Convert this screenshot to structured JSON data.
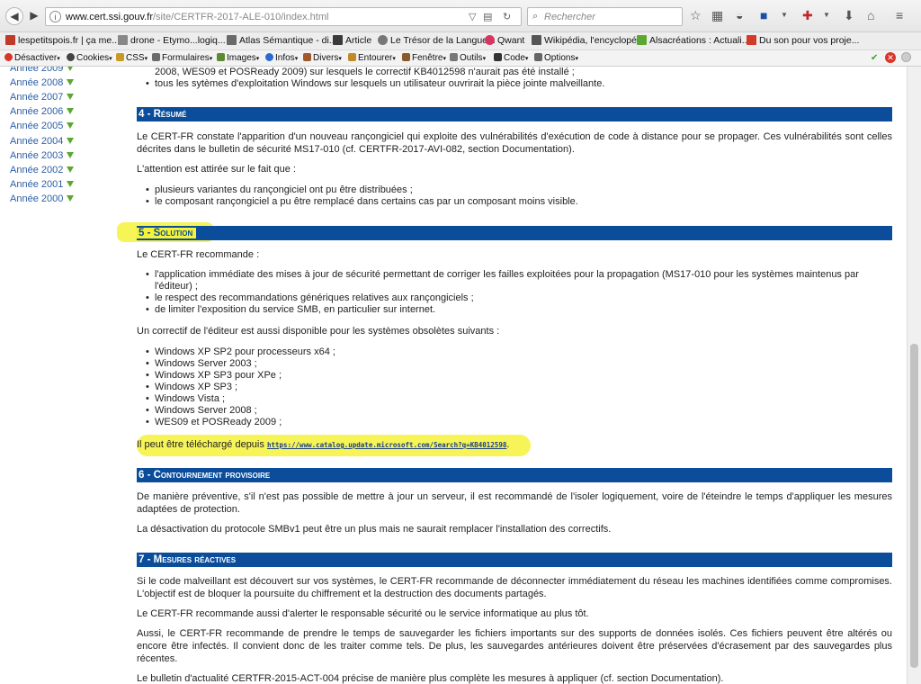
{
  "browser": {
    "url_domain": "www.cert.ssi.gouv.fr",
    "url_path": "/site/CERTFR-2017-ALE-010/index.html",
    "search_placeholder": "Rechercher"
  },
  "bookmarks": [
    {
      "label": "lespetitspois.fr | ça me...",
      "color": "#c0392b"
    },
    {
      "label": "drone - Etymo...logiq...",
      "color": "#888888"
    },
    {
      "label": "Atlas Sémantique - di...",
      "color": "#6a6a6a"
    },
    {
      "label": "Article",
      "color": "#3a3a3a"
    },
    {
      "label": "Le Trésor de la Langue...",
      "color": "#777777"
    },
    {
      "label": "Qwant",
      "color": "#d6365f"
    },
    {
      "label": "Wikipédia, l'encyclopé...",
      "color": "#555555"
    },
    {
      "label": "Alsacréations : Actuali...",
      "color": "#5aa832"
    },
    {
      "label": "Du son pour vos proje...",
      "color": "#d43a2a"
    }
  ],
  "devbar": [
    {
      "label": "Désactiver",
      "color": "#d9352a"
    },
    {
      "label": "Cookies",
      "color": "#444444"
    },
    {
      "label": "CSS",
      "color": "#c79a24"
    },
    {
      "label": "Formulaires",
      "color": "#6b6b6b"
    },
    {
      "label": "Images",
      "color": "#5b8a2f"
    },
    {
      "label": "Infos",
      "color": "#2b6bd0"
    },
    {
      "label": "Divers",
      "color": "#a05a2c"
    },
    {
      "label": "Entourer",
      "color": "#c08a2a"
    },
    {
      "label": "Fenêtre",
      "color": "#8a5a2a"
    },
    {
      "label": "Outils",
      "color": "#777777"
    },
    {
      "label": "Code",
      "color": "#333333"
    },
    {
      "label": "Options",
      "color": "#666666"
    }
  ],
  "sidebar": {
    "years": [
      "Année 2009",
      "Année 2008",
      "Année 2007",
      "Année 2006",
      "Année 2005",
      "Année 2004",
      "Année 2003",
      "Année 2002",
      "Année 2001",
      "Année 2000"
    ]
  },
  "content": {
    "top_bullets": [
      "2008, WES09 et POSReady 2009) sur lesquels le correctif KB4012598 n'aurait pas été installé ;",
      "tous les sytèmes d'exploitation Windows sur lesquels un utilisateur ouvrirait la pièce jointe malveillante."
    ],
    "s4_title": "4 - Résumé",
    "s4_p1": "Le CERT-FR constate l'apparition d'un nouveau rançongiciel qui exploite des vulnérabilités d'exécution de code à distance pour se propager. Ces vulnérabilités sont celles décrites dans le bulletin de sécurité MS17-010 (cf. CERTFR-2017-AVI-082, section Documentation).",
    "s4_p2": "L'attention est attirée sur le fait que :",
    "s4_bullets": [
      "plusieurs variantes du rançongiciel ont pu être distribuées ;",
      "le composant rançongiciel a pu être remplacé dans certains cas par un composant moins visible."
    ],
    "s5_title": "5 - Solution",
    "s5_p1": "Le CERT-FR recommande :",
    "s5_bullets": [
      "l'application immédiate des mises à jour de sécurité permettant de corriger les failles exploitées pour la propagation (MS17-010 pour les systèmes maintenus par l'éditeur) ;",
      "le respect des recommandations génériques relatives aux rançongiciels ;",
      "de limiter l'exposition du service SMB, en particulier sur internet."
    ],
    "s5_p2": "Un correctif de l'éditeur est aussi disponible pour les systèmes obsolètes suivants :",
    "s5_os": [
      "Windows XP SP2 pour processeurs x64 ;",
      "Windows Server 2003 ;",
      "Windows XP SP3 pour XPe ;",
      "Windows XP SP3 ;",
      "Windows Vista ;",
      "Windows Server 2008 ;",
      "WES09 et POSReady 2009 ;"
    ],
    "s5_download_text": "Il peut être téléchargé depuis",
    "s5_download_link": "https://www.catalog.update.microsoft.com/Search?q=KB4012598",
    "s6_title": "6 - Contournement provisoire",
    "s6_p1": "De manière préventive, s'il n'est pas possible de mettre à jour un serveur, il est recommandé de l'isoler logiquement, voire de l'éteindre le temps d'appliquer les mesures adaptées de protection.",
    "s6_p2": "La désactivation du protocole SMBv1 peut être un plus mais ne saurait remplacer l'installation des correctifs.",
    "s7_title": "7 - Mesures réactives",
    "s7_p1": "Si le code malveillant est découvert sur vos systèmes, le CERT-FR recommande de déconnecter immédiatement du réseau les machines identifiées comme compromises. L'objectif est de bloquer la poursuite du chiffrement et la destruction des documents partagés.",
    "s7_p2": "Le CERT-FR recommande aussi d'alerter le responsable sécurité ou le service informatique au plus tôt.",
    "s7_p3": "Aussi, le CERT-FR recommande de prendre le temps de sauvegarder les fichiers importants sur des supports de données isolés. Ces fichiers peuvent être altérés ou encore être infectés. Il convient donc de les traiter comme tels. De plus, les sauvegardes antérieures doivent être préservées d'écrasement par des sauvegardes plus récentes.",
    "s7_p4": "Le bulletin d'actualité CERTFR-2015-ACT-004 précise de manière plus complète les mesures à appliquer (cf. section Documentation)."
  },
  "colors": {
    "heading_bg": "#0b4d9a",
    "link": "#2b5ea6",
    "highlight": "#f5f23a"
  }
}
